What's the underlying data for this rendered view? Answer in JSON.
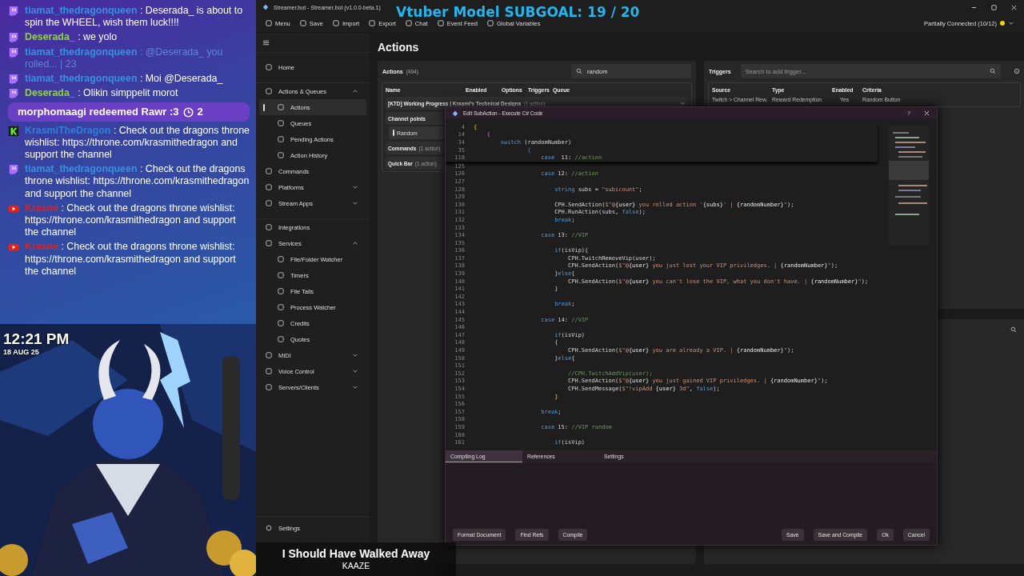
{
  "chat": {
    "messages": [
      {
        "kind": "twitch",
        "user": "tiamat_thedragonqueen",
        "color": "#3a8fe0",
        "text": ": Deserada_ is about to spin the WHEEL, wish them luck!!!!",
        "mention": false
      },
      {
        "kind": "twitch",
        "user": "Deserada_",
        "color": "#8ed04a",
        "text": ": we yolo",
        "mention": false
      },
      {
        "kind": "twitch",
        "user": "tiamat_thedragonqueen",
        "color": "#3a8fe0",
        "text": ": @Deserada_ you rolled... | 23",
        "mention": true
      },
      {
        "kind": "twitch",
        "user": "tiamat_thedragonqueen",
        "color": "#3a8fe0",
        "text": ": Moi @Deserada_",
        "mention": false
      },
      {
        "kind": "twitch",
        "user": "Deserada_",
        "color": "#8ed04a",
        "text": ": Olikin simppelit morot",
        "mention": false
      },
      {
        "kind": "redeem",
        "text": "morphomaagi redeemed Rawr :3",
        "cost": "2"
      },
      {
        "kind": "kick",
        "user": "KrasmiTheDragon",
        "color": "#2f7fd8",
        "text": ": Check out the dragons throne wishlist: https://throne.com/krasmithedragon and support the channel",
        "mention": false
      },
      {
        "kind": "twitch",
        "user": "tiamat_thedragonqueen",
        "color": "#3a8fe0",
        "text": ": Check out the dragons throne wishlist: https://throne.com/krasmithedragon and support the channel",
        "mention": false
      },
      {
        "kind": "youtube",
        "user": "Krasmi",
        "color": "#d6232a",
        "text": ": Check out the dragons throne wishlist: https://throne.com/krasmithedragon and support the channel",
        "mention": false
      },
      {
        "kind": "youtube",
        "user": "Krasmi",
        "color": "#d6232a",
        "text": ": Check out the dragons throne wishlist: https://throne.com/krasmithedragon and support the channel",
        "mention": false
      }
    ]
  },
  "clock": {
    "time": "12:21 PM",
    "date": "18 AUG 25"
  },
  "overlay": {
    "subgoal": "Vtuber Model SUBGOAL: 19 / 20",
    "song_title": "I Should Have Walked Away",
    "song_artist": "KAAZE"
  },
  "window": {
    "title": "Streamer.bot - Streamer.bot (v1.0.0-beta.1)"
  },
  "toolbar": [
    "Menu",
    "Save",
    "Import",
    "Export",
    "Chat",
    "Event Feed",
    "Global Variables"
  ],
  "status": {
    "text": "Partially Connected (10/12)",
    "color": "#f2d40c"
  },
  "sidebar": {
    "sections": [
      [
        {
          "label": "Home",
          "selected": false
        }
      ],
      [
        {
          "label": "Actions & Queues",
          "selected": false,
          "expanded": true,
          "children": [
            {
              "label": "Actions",
              "selected": true
            },
            {
              "label": "Queues",
              "selected": false
            },
            {
              "label": "Pending Actions",
              "selected": false
            },
            {
              "label": "Action History",
              "selected": false
            }
          ]
        },
        {
          "label": "Commands",
          "selected": false
        },
        {
          "label": "Platforms",
          "selected": false,
          "expanded": false
        },
        {
          "label": "Stream Apps",
          "selected": false,
          "expanded": false
        }
      ],
      [
        {
          "label": "Integrations",
          "selected": false
        },
        {
          "label": "Services",
          "selected": false,
          "expanded": true,
          "children": [
            {
              "label": "File/Folder Watcher",
              "selected": false
            },
            {
              "label": "Timers",
              "selected": false
            },
            {
              "label": "File Tails",
              "selected": false
            },
            {
              "label": "Process Watcher",
              "selected": false
            },
            {
              "label": "Credits",
              "selected": false
            },
            {
              "label": "Quotes",
              "selected": false
            }
          ]
        },
        {
          "label": "MIDI",
          "selected": false,
          "expanded": false
        },
        {
          "label": "Voice Control",
          "selected": false,
          "expanded": false
        },
        {
          "label": "Servers/Clients",
          "selected": false,
          "expanded": false
        }
      ]
    ],
    "footer": [
      {
        "label": "Settings",
        "selected": false
      }
    ]
  },
  "page_title": "Actions",
  "actions": {
    "label": "Actions",
    "count": "(494)",
    "search": "random",
    "columns": [
      "Name",
      "Enabled",
      "Options",
      "Triggers",
      "Queue"
    ],
    "groups": [
      {
        "name": "[KTD] Working Progress | Krasmi's Technical Designs",
        "count": "(1 action)",
        "expanded": false
      },
      {
        "name": "Channel points",
        "expanded": true,
        "children": [
          {
            "name": "Random",
            "selected": true
          }
        ]
      },
      {
        "name": "Commands",
        "count": "(1 action)",
        "expanded": false
      },
      {
        "name": "Quick Bar",
        "count": "(1 action)",
        "expanded": false
      }
    ]
  },
  "triggers": {
    "label": "Triggers",
    "placeholder": "Search to add trigger...",
    "columns": [
      "Source",
      "Type",
      "Enabled",
      "Criteria"
    ],
    "rows": [
      [
        "Twitch > Channel Rew.",
        "Reward Redemption",
        "Yes",
        "Random Button"
      ]
    ]
  },
  "dialog": {
    "title": "Edit SubAction - Execute C# Code",
    "help": "?",
    "sticky_lines": [
      {
        "number": "4",
        "tokens": [
          {
            "kind": "brace1",
            "text": "{"
          }
        ]
      },
      {
        "number": "14",
        "tokens": [
          {
            "kind": "brace2",
            "text": "    {"
          }
        ]
      },
      {
        "number": "34",
        "tokens": [
          {
            "kind": "keyword",
            "text": "        switch"
          },
          {
            "kind": "plain",
            "text": " (randomNumber)"
          }
        ]
      },
      {
        "number": "35",
        "tokens": [
          {
            "kind": "brace3",
            "text": "                {"
          }
        ]
      },
      {
        "number": "118",
        "tokens": [
          {
            "kind": "keyword",
            "text": "                    case"
          },
          {
            "kind": "plain",
            "text": "  11: "
          },
          {
            "kind": "comment",
            "text": "//action"
          }
        ]
      }
    ],
    "lines": [
      {
        "number": "125"
      },
      {
        "number": "126",
        "tokens": [
          {
            "kind": "keyword",
            "text": "                    case"
          },
          {
            "kind": "plain",
            "text": " 12: "
          },
          {
            "kind": "comment",
            "text": "//action"
          }
        ]
      },
      {
        "number": "127"
      },
      {
        "number": "128",
        "tokens": [
          {
            "kind": "keyword",
            "text": "                        string"
          },
          {
            "kind": "plain",
            "text": " subs = "
          },
          {
            "kind": "string",
            "text": "\"subicount\""
          },
          {
            "kind": "plain",
            "text": ";"
          }
        ]
      },
      {
        "number": "129"
      },
      {
        "number": "130",
        "tokens": [
          {
            "kind": "plain",
            "text": "                        CPH.SendAction("
          },
          {
            "kind": "string",
            "text": "$\"@"
          },
          {
            "kind": "variable",
            "text": "{user}"
          },
          {
            "kind": "string",
            "text": " you rolled action '"
          },
          {
            "kind": "variable",
            "text": "{subs}"
          },
          {
            "kind": "string",
            "text": "' | "
          },
          {
            "kind": "variable",
            "text": "{randomNumber}"
          },
          {
            "kind": "string",
            "text": "\""
          },
          {
            "kind": "plain",
            "text": ");"
          }
        ]
      },
      {
        "number": "131",
        "tokens": [
          {
            "kind": "plain",
            "text": "                        CPH.RunAction(subs, "
          },
          {
            "kind": "keyword",
            "text": "false"
          },
          {
            "kind": "plain",
            "text": ");"
          }
        ]
      },
      {
        "number": "132",
        "tokens": [
          {
            "kind": "keyword",
            "text": "                        break"
          },
          {
            "kind": "plain",
            "text": ";"
          }
        ]
      },
      {
        "number": "133"
      },
      {
        "number": "134",
        "tokens": [
          {
            "kind": "keyword",
            "text": "                    case"
          },
          {
            "kind": "plain",
            "text": " 13: "
          },
          {
            "kind": "comment",
            "text": "//VIP"
          }
        ]
      },
      {
        "number": "135"
      },
      {
        "number": "136",
        "tokens": [
          {
            "kind": "keyword",
            "text": "                        if"
          },
          {
            "kind": "plain",
            "text": "(isVip){"
          }
        ]
      },
      {
        "number": "137",
        "tokens": [
          {
            "kind": "plain",
            "text": "                            CPH.TwitchRemoveVip(user);"
          }
        ]
      },
      {
        "number": "138",
        "tokens": [
          {
            "kind": "plain",
            "text": "                            CPH.SendAction("
          },
          {
            "kind": "string",
            "text": "$\"@"
          },
          {
            "kind": "variable",
            "text": "{user}"
          },
          {
            "kind": "string",
            "text": " you just lost your VIP priviledges. | "
          },
          {
            "kind": "variable",
            "text": "{randomNumber}"
          },
          {
            "kind": "string",
            "text": "\""
          },
          {
            "kind": "plain",
            "text": ");"
          }
        ]
      },
      {
        "number": "139",
        "tokens": [
          {
            "kind": "plain",
            "text": "                        }"
          },
          {
            "kind": "keyword",
            "text": "else"
          },
          {
            "kind": "plain",
            "text": "{"
          }
        ]
      },
      {
        "number": "140",
        "tokens": [
          {
            "kind": "plain",
            "text": "                            CPH.SendAction("
          },
          {
            "kind": "string",
            "text": "$\"@"
          },
          {
            "kind": "variable",
            "text": "{user}"
          },
          {
            "kind": "string",
            "text": " you can't lose the VIP, what you don't have. | "
          },
          {
            "kind": "variable",
            "text": "{randomNumber}"
          },
          {
            "kind": "string",
            "text": "\""
          },
          {
            "kind": "plain",
            "text": ");"
          }
        ]
      },
      {
        "number": "141",
        "tokens": [
          {
            "kind": "plain",
            "text": "                        }"
          }
        ]
      },
      {
        "number": "142"
      },
      {
        "number": "143",
        "tokens": [
          {
            "kind": "keyword",
            "text": "                        break"
          },
          {
            "kind": "plain",
            "text": ";"
          }
        ]
      },
      {
        "number": "144"
      },
      {
        "number": "145",
        "tokens": [
          {
            "kind": "keyword",
            "text": "                    case"
          },
          {
            "kind": "plain",
            "text": " 14: "
          },
          {
            "kind": "comment",
            "text": "//VIP"
          }
        ]
      },
      {
        "number": "146"
      },
      {
        "number": "147",
        "tokens": [
          {
            "kind": "keyword",
            "text": "                        if"
          },
          {
            "kind": "plain",
            "text": "(isVip)"
          }
        ]
      },
      {
        "number": "148",
        "tokens": [
          {
            "kind": "plain",
            "text": "                        {"
          }
        ]
      },
      {
        "number": "149",
        "tokens": [
          {
            "kind": "plain",
            "text": "                            CPH.SendAction("
          },
          {
            "kind": "string",
            "text": "$\"@"
          },
          {
            "kind": "variable",
            "text": "{user}"
          },
          {
            "kind": "string",
            "text": " you are already a VIP. | "
          },
          {
            "kind": "variable",
            "text": "{randomNumber}"
          },
          {
            "kind": "string",
            "text": "\""
          },
          {
            "kind": "plain",
            "text": ");"
          }
        ]
      },
      {
        "number": "150",
        "tokens": [
          {
            "kind": "plain",
            "text": "                        }"
          },
          {
            "kind": "keyword",
            "text": "else"
          },
          {
            "kind": "plain",
            "text": "{"
          }
        ]
      },
      {
        "number": "151"
      },
      {
        "number": "152",
        "tokens": [
          {
            "kind": "comment",
            "text": "                            //CPH.TwitchAddVip(user);"
          }
        ]
      },
      {
        "number": "153",
        "tokens": [
          {
            "kind": "plain",
            "text": "                            CPH.SendAction("
          },
          {
            "kind": "string",
            "text": "$\"@"
          },
          {
            "kind": "variable",
            "text": "{user}"
          },
          {
            "kind": "string",
            "text": " you just gained VIP priviledges. | "
          },
          {
            "kind": "variable",
            "text": "{randomNumber}"
          },
          {
            "kind": "string",
            "text": "\""
          },
          {
            "kind": "plain",
            "text": ");"
          }
        ]
      },
      {
        "number": "154",
        "tokens": [
          {
            "kind": "plain",
            "text": "                            CPH.SendMessage("
          },
          {
            "kind": "string",
            "text": "$\"!vipAdd "
          },
          {
            "kind": "variable",
            "text": "{user}"
          },
          {
            "kind": "string",
            "text": " 3d\""
          },
          {
            "kind": "plain",
            "text": ", "
          },
          {
            "kind": "keyword",
            "text": "false"
          },
          {
            "kind": "plain",
            "text": ");"
          }
        ]
      },
      {
        "number": "155",
        "tokens": [
          {
            "kind": "brace1",
            "text": "                        }"
          }
        ]
      },
      {
        "number": "156"
      },
      {
        "number": "157",
        "tokens": [
          {
            "kind": "keyword",
            "text": "                    break"
          },
          {
            "kind": "plain",
            "text": ";"
          }
        ]
      },
      {
        "number": "158"
      },
      {
        "number": "159",
        "tokens": [
          {
            "kind": "keyword",
            "text": "                    case"
          },
          {
            "kind": "plain",
            "text": " 15: "
          },
          {
            "kind": "comment",
            "text": "//VIP random"
          }
        ]
      },
      {
        "number": "160"
      },
      {
        "number": "161",
        "tokens": [
          {
            "kind": "keyword",
            "text": "                        if"
          },
          {
            "kind": "plain",
            "text": "(isVip)"
          }
        ]
      }
    ],
    "tabs": [
      {
        "label": "Compiling Log",
        "selected": true
      },
      {
        "label": "References",
        "selected": false
      },
      {
        "label": "Settings",
        "selected": false
      }
    ],
    "buttons_left": [
      "Format Document",
      "Find Refs",
      "Compile"
    ],
    "buttons_right": [
      "Save",
      "Save and Compile",
      "Ok",
      "Cancel"
    ]
  }
}
